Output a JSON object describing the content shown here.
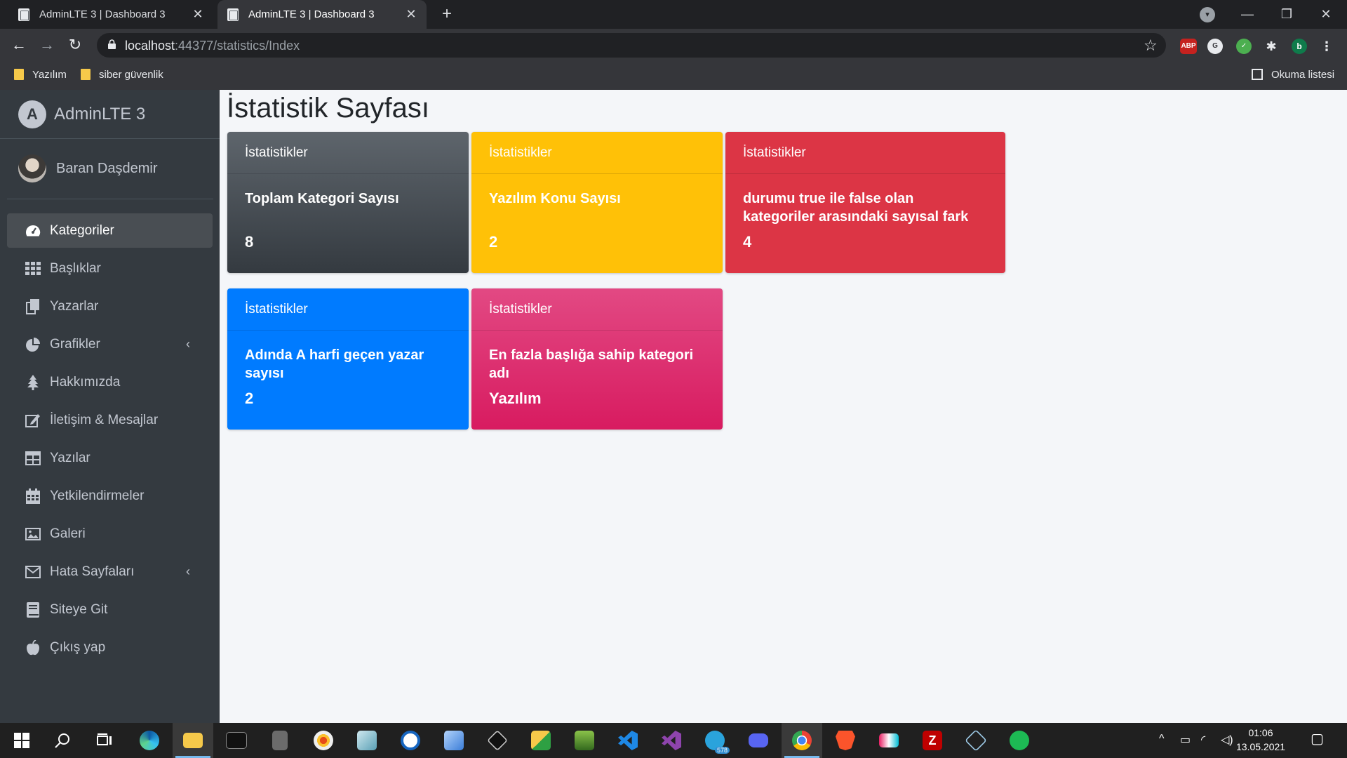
{
  "browser": {
    "tabs": [
      {
        "title": "AdminLTE 3 | Dashboard 3",
        "active": false
      },
      {
        "title": "AdminLTE 3 | Dashboard 3",
        "active": true
      }
    ],
    "new_tab_symbol": "+",
    "close_symbol": "✕",
    "url_host": "localhost",
    "url_rest": ":44377/statistics/Index",
    "bookmarks": [
      "Yazılım",
      "siber güvenlik"
    ],
    "reading_list": "Okuma listesi",
    "profile_initial": "b",
    "ext_abp": "ABP"
  },
  "sidebar": {
    "brand": "AdminLTE 3",
    "brand_logo": "A",
    "user_name": "Baran Daşdemir",
    "items": [
      {
        "label": "Kategoriler",
        "icon": "tachometer-icon",
        "active": true
      },
      {
        "label": "Başlıklar",
        "icon": "grid-icon"
      },
      {
        "label": "Yazarlar",
        "icon": "copy-icon"
      },
      {
        "label": "Grafikler",
        "icon": "pie-chart-icon",
        "has_submenu": true
      },
      {
        "label": "Hakkımızda",
        "icon": "tree-icon"
      },
      {
        "label": "İletişim & Mesajlar",
        "icon": "edit-icon"
      },
      {
        "label": "Yazılar",
        "icon": "table-icon"
      },
      {
        "label": "Yetkilendirmeler",
        "icon": "calendar-icon"
      },
      {
        "label": "Galeri",
        "icon": "image-icon"
      },
      {
        "label": "Hata Sayfaları",
        "icon": "envelope-icon",
        "has_submenu": true
      },
      {
        "label": "Siteye Git",
        "icon": "book-icon"
      },
      {
        "label": "Çıkış yap",
        "icon": "apple-icon"
      }
    ]
  },
  "main": {
    "page_title": "İstatistik Sayfası",
    "cards": [
      {
        "header": "İstatistikler",
        "title": "Toplam Kategori Sayısı",
        "value": "8",
        "color": "#343a40"
      },
      {
        "header": "İstatistikler",
        "title": "Yazılım Konu Sayısı",
        "value": "2",
        "color": "#ffc107"
      },
      {
        "header": "İstatistikler",
        "title": "durumu true ile false olan kategoriler arasındaki sayısal fark",
        "value": "4",
        "color": "#dc3545"
      },
      {
        "header": "İstatistikler",
        "title": "Adında A harfi geçen yazar sayısı",
        "value": "2",
        "color": "#007bff"
      },
      {
        "header": "İstatistikler",
        "title": "En fazla başlığa sahip kategori adı",
        "value": "Yazılım",
        "color": "#d81b60"
      }
    ]
  },
  "taskbar": {
    "time": "01:06",
    "date": "13.05.2021",
    "telegram_badge": "578"
  }
}
